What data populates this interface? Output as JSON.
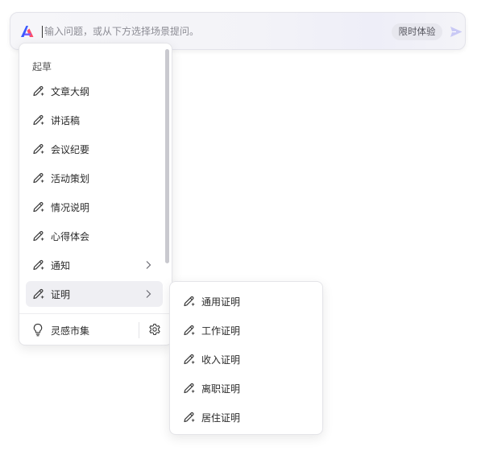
{
  "prompt_bar": {
    "placeholder": "输入问题，或从下方选择场景提问。",
    "trial_badge": "限时体验",
    "logo_icon": "wps-ai-logo-icon",
    "send_icon": "send-arrow-icon"
  },
  "menu": {
    "section_title": "起草",
    "items": [
      {
        "label": "文章大纲",
        "icon": "pen-sparkle-icon"
      },
      {
        "label": "讲话稿",
        "icon": "pen-sparkle-icon"
      },
      {
        "label": "会议纪要",
        "icon": "pen-sparkle-icon"
      },
      {
        "label": "活动策划",
        "icon": "pen-sparkle-icon"
      },
      {
        "label": "情况说明",
        "icon": "pen-sparkle-icon"
      },
      {
        "label": "心得体会",
        "icon": "pen-sparkle-icon"
      },
      {
        "label": "通知",
        "icon": "pen-sparkle-icon",
        "has_submenu": true
      },
      {
        "label": "证明",
        "icon": "pen-sparkle-icon",
        "has_submenu": true,
        "active": true
      }
    ],
    "footer": {
      "market_label": "灵感市集",
      "market_icon": "lightbulb-icon",
      "settings_icon": "gear-icon"
    }
  },
  "submenu": {
    "parent": "证明",
    "items": [
      {
        "label": "通用证明",
        "icon": "pen-sparkle-icon"
      },
      {
        "label": "工作证明",
        "icon": "pen-sparkle-icon"
      },
      {
        "label": "收入证明",
        "icon": "pen-sparkle-icon"
      },
      {
        "label": "离职证明",
        "icon": "pen-sparkle-icon"
      },
      {
        "label": "居住证明",
        "icon": "pen-sparkle-icon"
      }
    ]
  },
  "colors": {
    "accent_send": "#c9c9f5",
    "logo_blue": "#3d5afe",
    "logo_red": "#ff4d6a",
    "active_item_bg": "#efeff3"
  }
}
